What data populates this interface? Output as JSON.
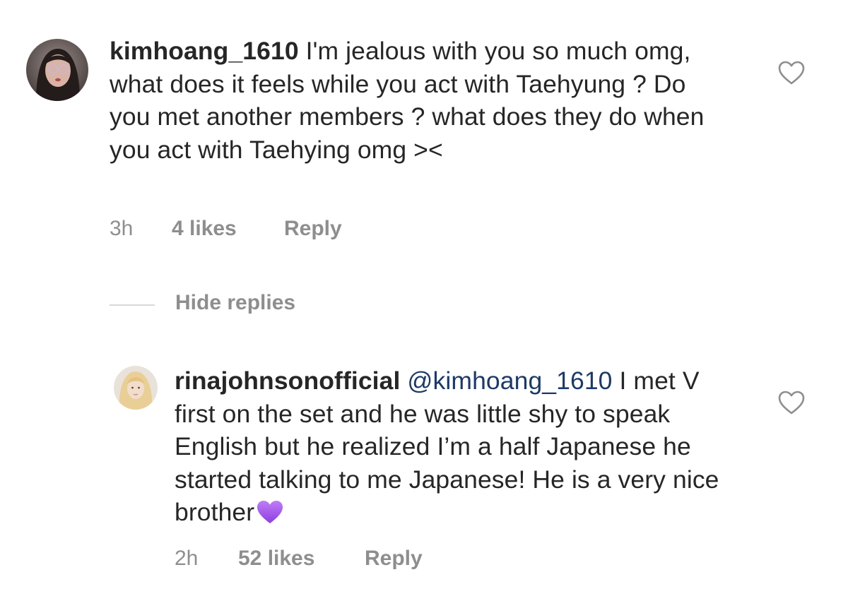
{
  "comments": [
    {
      "username": "kimhoang_1610",
      "text": "I'm jealous with you so much omg, what does it feels while you act with Taehyung ? Do you met another members ? what does they do when you act with Taehying omg ><",
      "time": "3h",
      "likes": "4 likes",
      "reply_label": "Reply",
      "avatar_icon": "user-avatar",
      "like_icon": "heart-outline-icon"
    }
  ],
  "hide_replies_label": "Hide replies",
  "replies": [
    {
      "username": "rinajohnsonofficial",
      "mention": "@kimhoang_1610",
      "text": "I met V first on the set and he was little shy to speak English but he realized I’m a half Japanese he started talking to me Japanese! He is a very nice brother",
      "emoji": "purple-heart",
      "time": "2h",
      "likes": "52 likes",
      "reply_label": "Reply",
      "avatar_icon": "user-avatar",
      "like_icon": "heart-outline-icon"
    }
  ],
  "colors": {
    "text": "#262626",
    "secondary": "#8e8e8e",
    "mention": "#1b3a6b",
    "divider": "#d8d8d8",
    "purple_heart": "#a95cf0"
  }
}
